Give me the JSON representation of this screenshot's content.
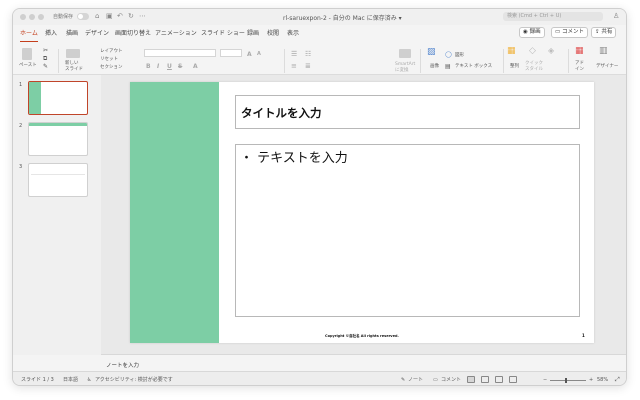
{
  "titlebar": {
    "autosave_label": "自動保存",
    "doc_title": "rl-saruexpon-2 - 自分の Mac に保存済み ▾",
    "search_placeholder": "検索 (Cmd + Ctrl + U)",
    "icons": [
      "home-icon",
      "save-icon",
      "undo-icon",
      "redo-icon",
      "more-icon",
      "account-icon"
    ]
  },
  "tabs": [
    "ホーム",
    "挿入",
    "描画",
    "デザイン",
    "画面切り替え",
    "アニメーション",
    "スライド ショー",
    "録画",
    "校閲",
    "表示"
  ],
  "active_tab": "ホーム",
  "top_right": {
    "record_label": "録画",
    "comment_label": "コメント",
    "share_label": "共有"
  },
  "ribbon": {
    "paste_label": "ペースト",
    "new_slide_label": "新しい\nスライド",
    "layout_label": "レイアウト",
    "reset_label": "リセット",
    "section_label": "セクション",
    "smartart_label": "SmartArt\nに変換",
    "picture_label": "画像",
    "shapes_label": "図形",
    "textbox_label": "テキスト ボックス",
    "arrange_label": "整列",
    "quickstyles_label": "クイック\nスタイル",
    "addins_label": "アド\nイン",
    "designer_label": "デザイナー"
  },
  "thumbnails": [
    {
      "num": "1",
      "selected": true
    },
    {
      "num": "2",
      "selected": false
    },
    {
      "num": "3",
      "selected": false
    }
  ],
  "slide": {
    "title_placeholder": "タイトルを入力",
    "body_placeholder": "・ テキストを入力",
    "copyright": "Copyright ©自社名 All rights reserved.",
    "page_number": "1",
    "accent_color": "#7dcea5"
  },
  "notes_placeholder": "ノートを入力",
  "statusbar": {
    "slide_counter": "スライド 1 / 3",
    "language": "日本語",
    "accessibility": "アクセシビリティ: 検討が必要です",
    "notes_label": "ノート",
    "comments_label": "コメント",
    "zoom_level": "58%"
  }
}
